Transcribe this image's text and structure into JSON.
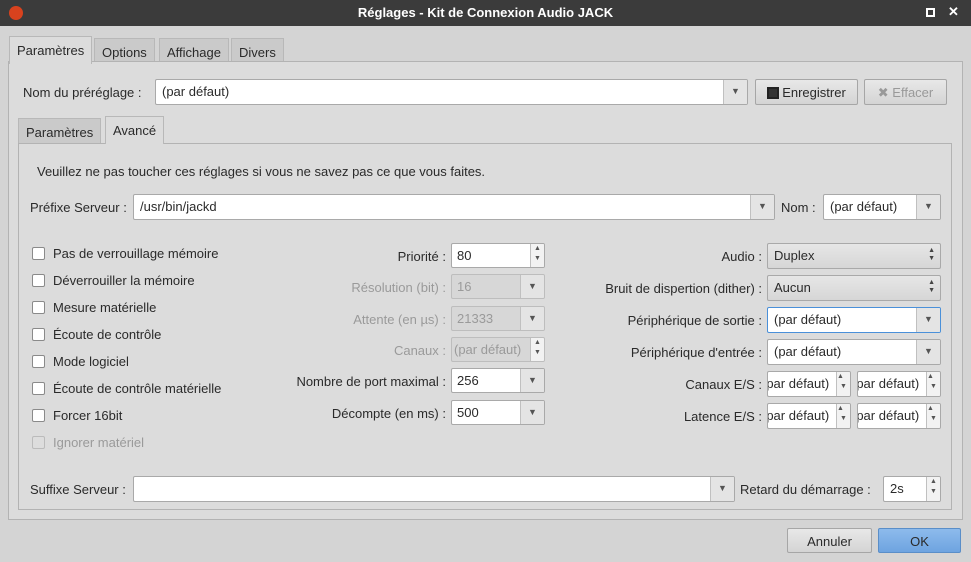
{
  "window": {
    "title": "Réglages - Kit de Connexion Audio JACK"
  },
  "tabs": [
    "Paramètres",
    "Options",
    "Affichage",
    "Divers"
  ],
  "preset": {
    "label": "Nom du préréglage :",
    "value": "(par défaut)",
    "save": "Enregistrer",
    "delete": "Effacer"
  },
  "subtabs": [
    "Paramètres",
    "Avancé"
  ],
  "warning": "Veuillez ne pas toucher ces réglages si vous ne savez pas ce que vous faites.",
  "server_prefix": {
    "label": "Préfixe Serveur :",
    "value": "/usr/bin/jackd"
  },
  "name": {
    "label": "Nom :",
    "value": "(par défaut)"
  },
  "checkboxes": [
    {
      "label": "Pas de verrouillage mémoire",
      "checked": false,
      "enabled": true
    },
    {
      "label": "Déverrouiller la mémoire",
      "checked": false,
      "enabled": true
    },
    {
      "label": "Mesure matérielle",
      "checked": false,
      "enabled": true
    },
    {
      "label": "Écoute de contrôle",
      "checked": false,
      "enabled": true
    },
    {
      "label": "Mode logiciel",
      "checked": false,
      "enabled": true
    },
    {
      "label": "Écoute de contrôle matérielle",
      "checked": false,
      "enabled": true
    },
    {
      "label": "Forcer 16bit",
      "checked": false,
      "enabled": true
    },
    {
      "label": "Ignorer matériel",
      "checked": false,
      "enabled": false
    }
  ],
  "middle": [
    {
      "label": "Priorité :",
      "value": "80"
    },
    {
      "label": "Résolution (bit) :",
      "value": "16"
    },
    {
      "label": "Attente (en µs) :",
      "value": "21333"
    },
    {
      "label": "Canaux :",
      "value": "(par défaut)"
    },
    {
      "label": "Nombre de port maximal :",
      "value": "256"
    },
    {
      "label": "Décompte (en ms) :",
      "value": "500"
    }
  ],
  "right": [
    {
      "label": "Audio :",
      "value": "Duplex"
    },
    {
      "label": "Bruit de dispertion (dither) :",
      "value": "Aucun"
    },
    {
      "label": "Périphérique de sortie :",
      "value": "(par défaut)"
    },
    {
      "label": "Périphérique d'entrée :",
      "value": "(par défaut)"
    },
    {
      "label": "Canaux E/S :",
      "in": "(par défaut)",
      "out": "(par défaut)"
    },
    {
      "label": "Latence E/S :",
      "in": "(par défaut)",
      "out": "(par défaut)"
    }
  ],
  "server_suffix": {
    "label": "Suffixe Serveur :",
    "value": ""
  },
  "start_delay": {
    "label": "Retard du démarrage :",
    "value": "2s"
  },
  "buttons": {
    "cancel": "Annuler",
    "ok": "OK"
  }
}
